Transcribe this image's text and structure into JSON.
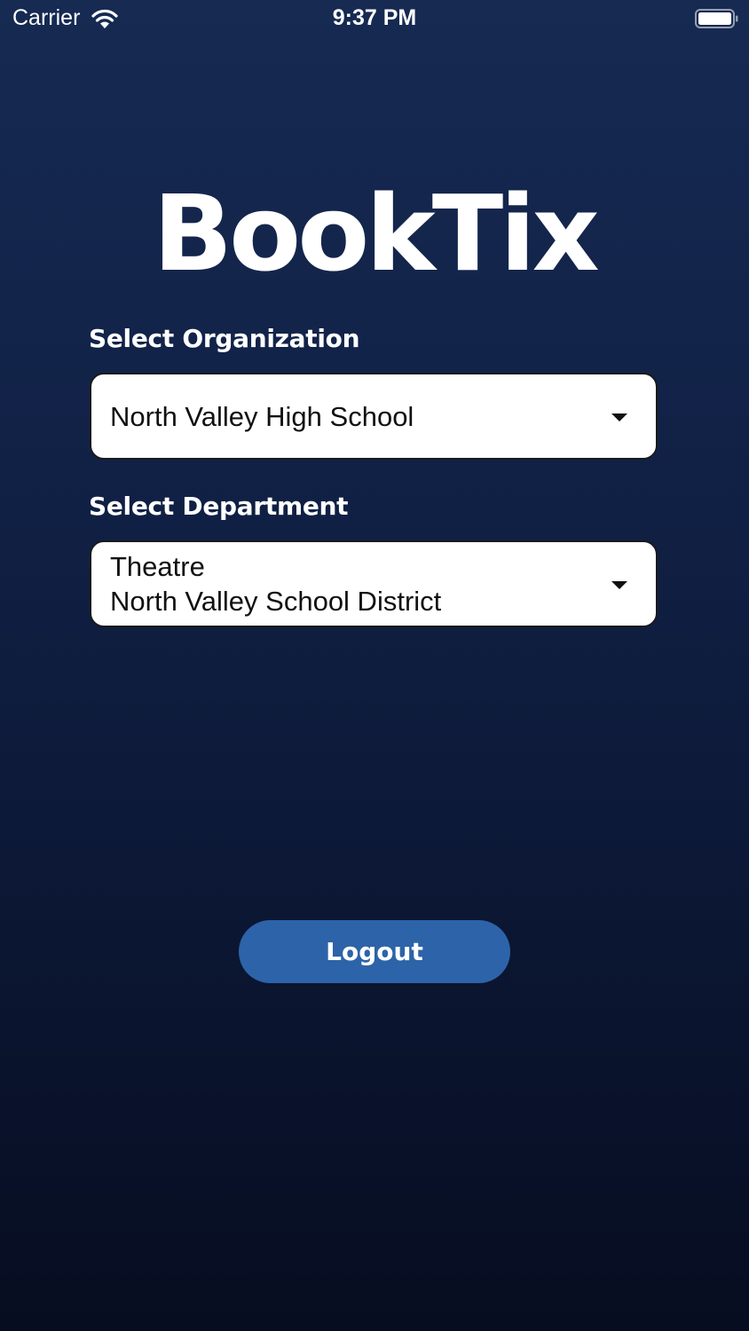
{
  "status_bar": {
    "carrier": "Carrier",
    "time": "9:37 PM",
    "wifi_icon": "wifi-icon",
    "battery_icon": "battery-full-icon"
  },
  "app": {
    "logo_text": "BookTix"
  },
  "organization": {
    "label": "Select Organization",
    "selected": "North Valley High School"
  },
  "department": {
    "label": "Select Department",
    "selected_line1": "Theatre",
    "selected_line2": "North Valley School District"
  },
  "actions": {
    "logout_label": "Logout"
  },
  "colors": {
    "background_top": "#162a52",
    "background_bottom": "#070d20",
    "button": "#2d63a8",
    "field_bg": "#ffffff"
  }
}
